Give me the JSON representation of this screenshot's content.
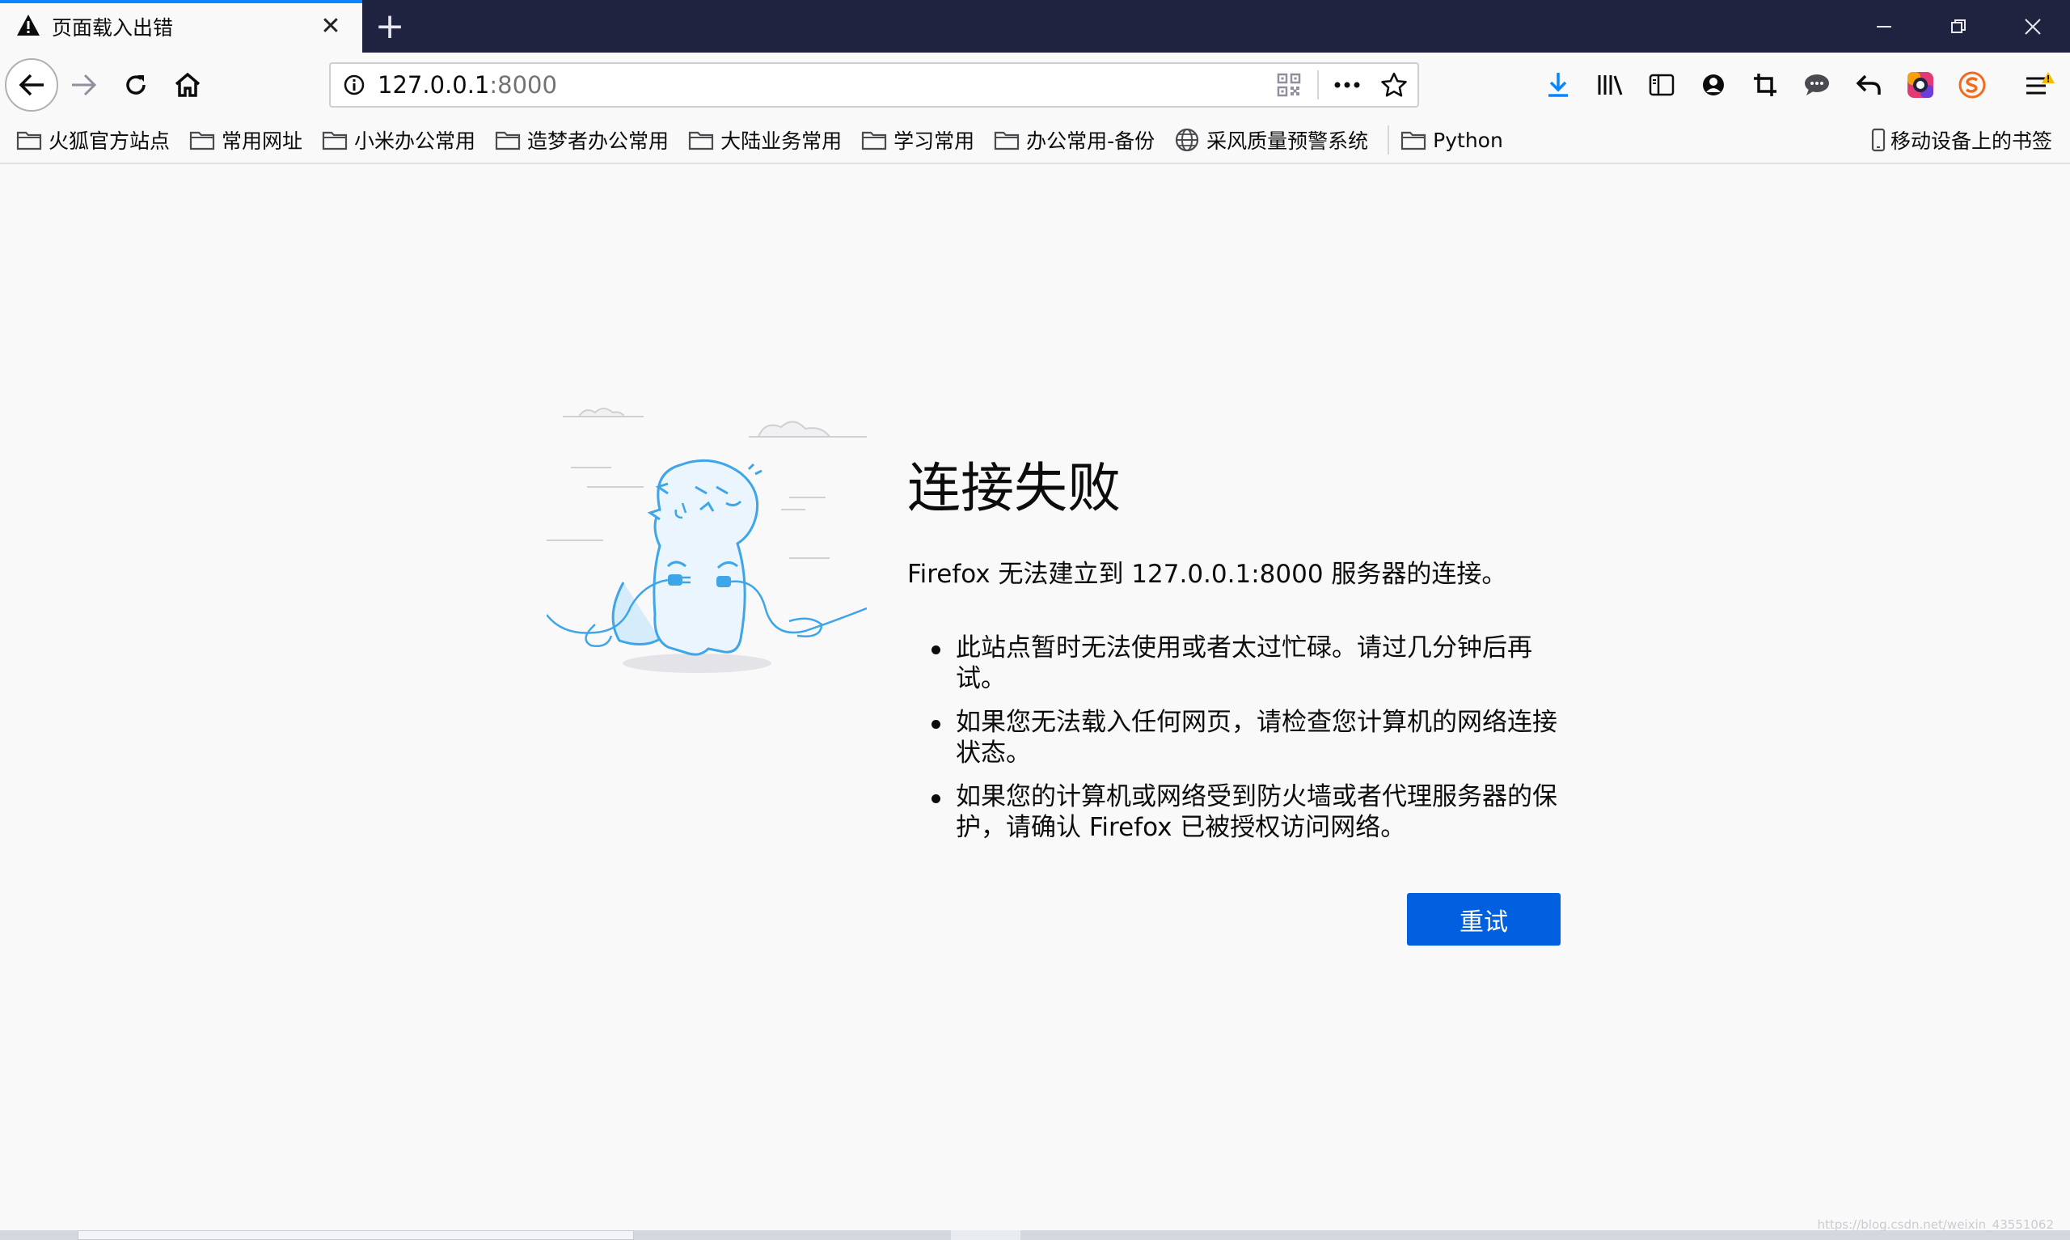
{
  "tab": {
    "title": "页面载入出错",
    "close": "✕"
  },
  "new_tab": "+",
  "url": {
    "host": "127.0.0.1",
    "port": ":8000"
  },
  "bookmarks": [
    "火狐官方站点",
    "常用网址",
    "小米办公常用",
    "造梦者办公常用",
    "大陆业务常用",
    "学习常用",
    "办公常用-备份",
    "采风质量预警系统",
    "Python"
  ],
  "mobile_bookmarks": "移动设备上的书签",
  "error": {
    "title": "连接失败",
    "description": "Firefox 无法建立到 127.0.0.1:8000 服务器的连接。",
    "items": [
      "此站点暂时无法使用或者太过忙碌。请过几分钟后再试。",
      "如果您无法载入任何网页，请检查您计算机的网络连接状态。",
      "如果您的计算机或网络受到防火墙或者代理服务器的保护，请确认 Firefox 已被授权访问网络。"
    ],
    "retry": "重试"
  },
  "watermark": "https://blog.csdn.net/weixin_43551062",
  "colors": {
    "tabbar": "#202340",
    "accent": "#0a84ff",
    "button": "#0060df"
  }
}
